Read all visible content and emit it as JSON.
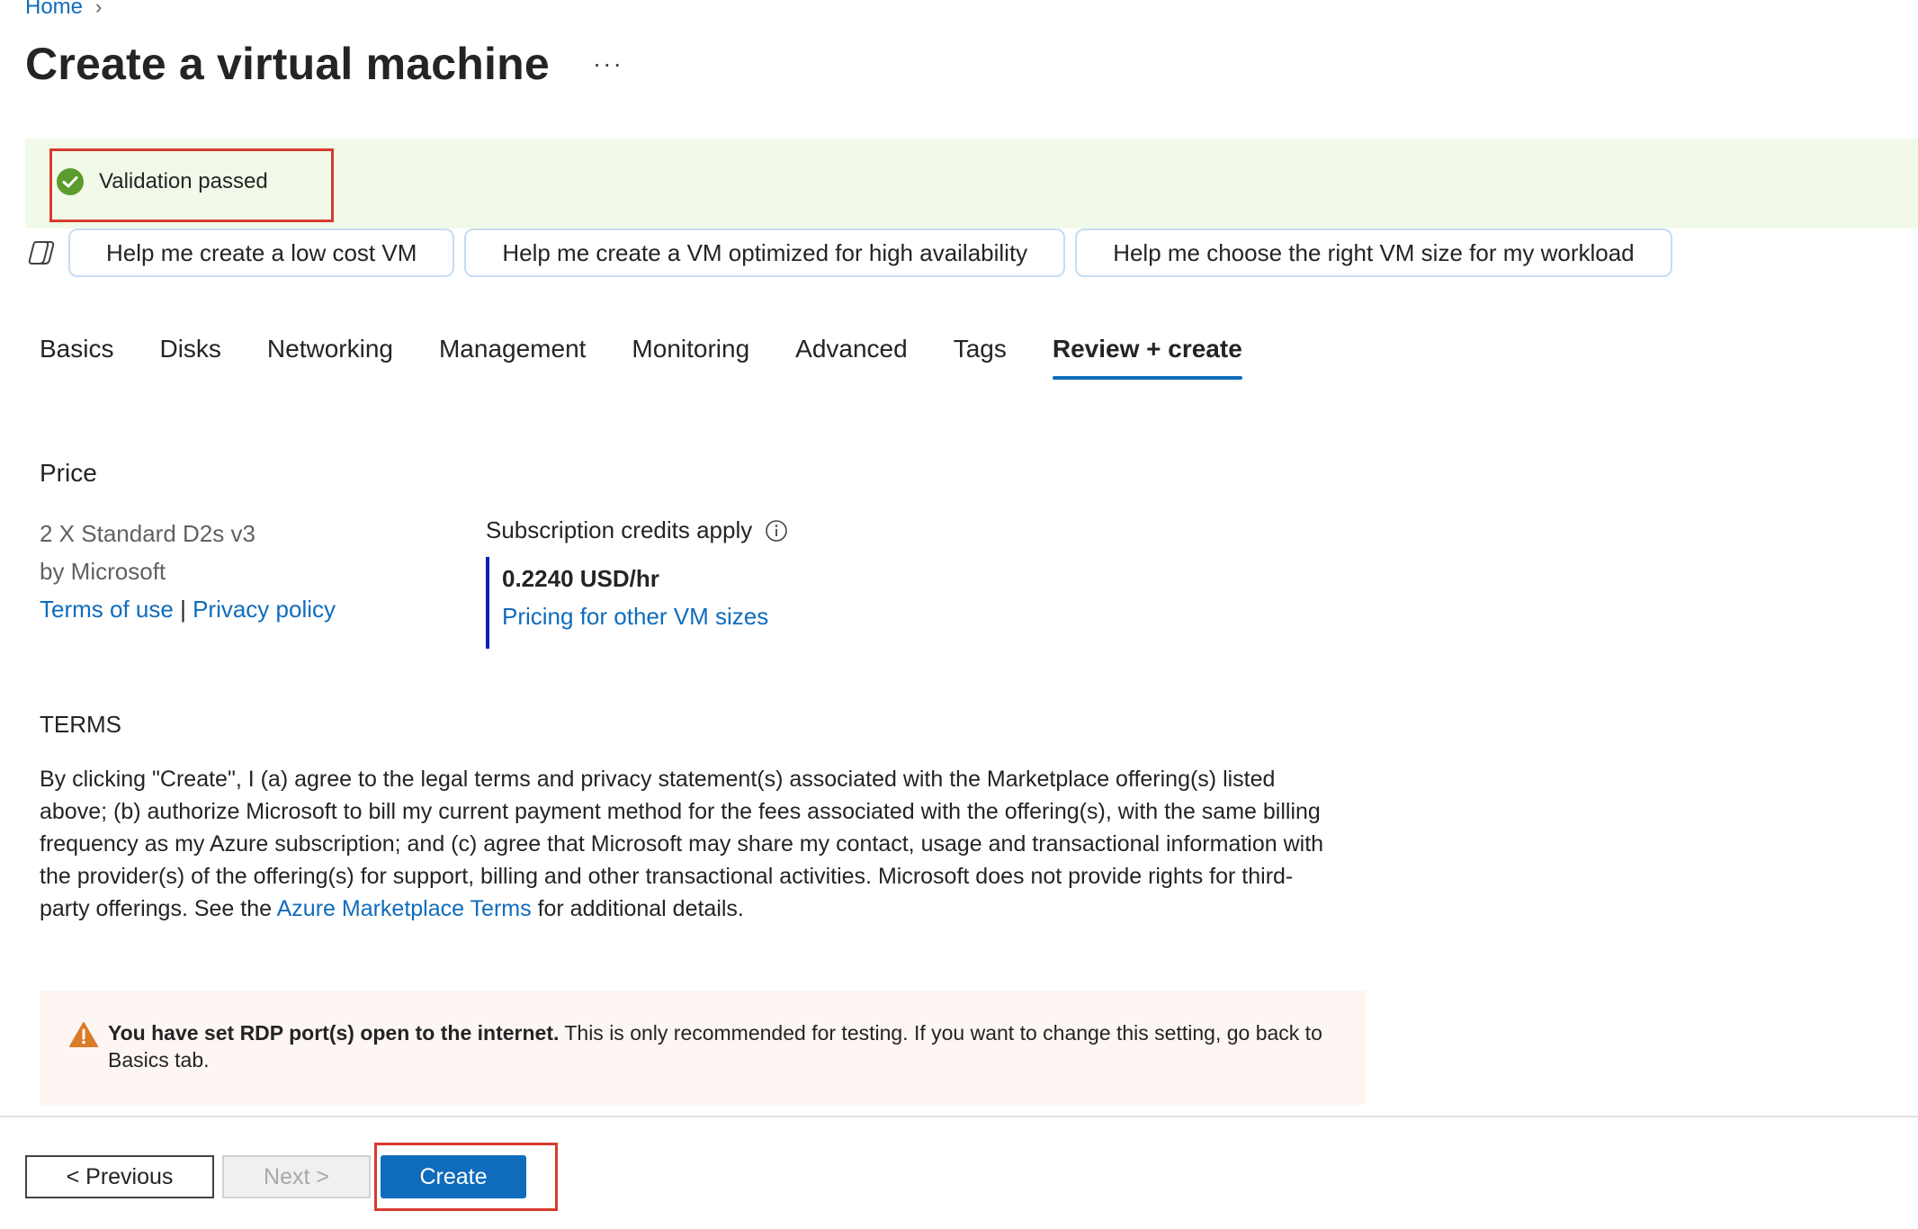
{
  "breadcrumb": {
    "home": "Home"
  },
  "page": {
    "title": "Create a virtual machine",
    "more": "···"
  },
  "validation": {
    "text": "Validation passed"
  },
  "copilot": {
    "chips": [
      "Help me create a low cost VM",
      "Help me create a VM optimized for high availability",
      "Help me choose the right VM size for my workload"
    ]
  },
  "tabs": [
    "Basics",
    "Disks",
    "Networking",
    "Management",
    "Monitoring",
    "Advanced",
    "Tags",
    "Review + create"
  ],
  "price": {
    "heading": "Price",
    "product": "2 X Standard D2s v3",
    "vendor": "by Microsoft",
    "terms_link": "Terms of use",
    "separator": "|",
    "privacy_link": "Privacy policy",
    "credits_label": "Subscription credits apply",
    "rate": "0.2240 USD/hr",
    "pricing_link": "Pricing for other VM sizes"
  },
  "terms": {
    "heading": "TERMS",
    "body": "By clicking \"Create\", I (a) agree to the legal terms and privacy statement(s) associated with the Marketplace offering(s) listed above; (b) authorize Microsoft to bill my current payment method for the fees associated with the offering(s), with the same billing frequency as my Azure subscription; and (c) agree that Microsoft may share my contact, usage and transactional information with the provider(s) of the offering(s) for support, billing and other transactional activities. Microsoft does not provide rights for third-party offerings. See the",
    "link": "Azure Marketplace Terms",
    "tail": "for additional details."
  },
  "warning": {
    "bold": "You have set RDP port(s) open to the internet.",
    "text": "This is only recommended for testing.  If you want to change this setting, go back to Basics tab."
  },
  "footer": {
    "previous": "< Previous",
    "next": "Next >",
    "create": "Create"
  },
  "colors": {
    "accent": "#0f6cbd",
    "success": "#5b9c2d",
    "warning": "#da7b29",
    "highlight": "#d83b2e"
  }
}
